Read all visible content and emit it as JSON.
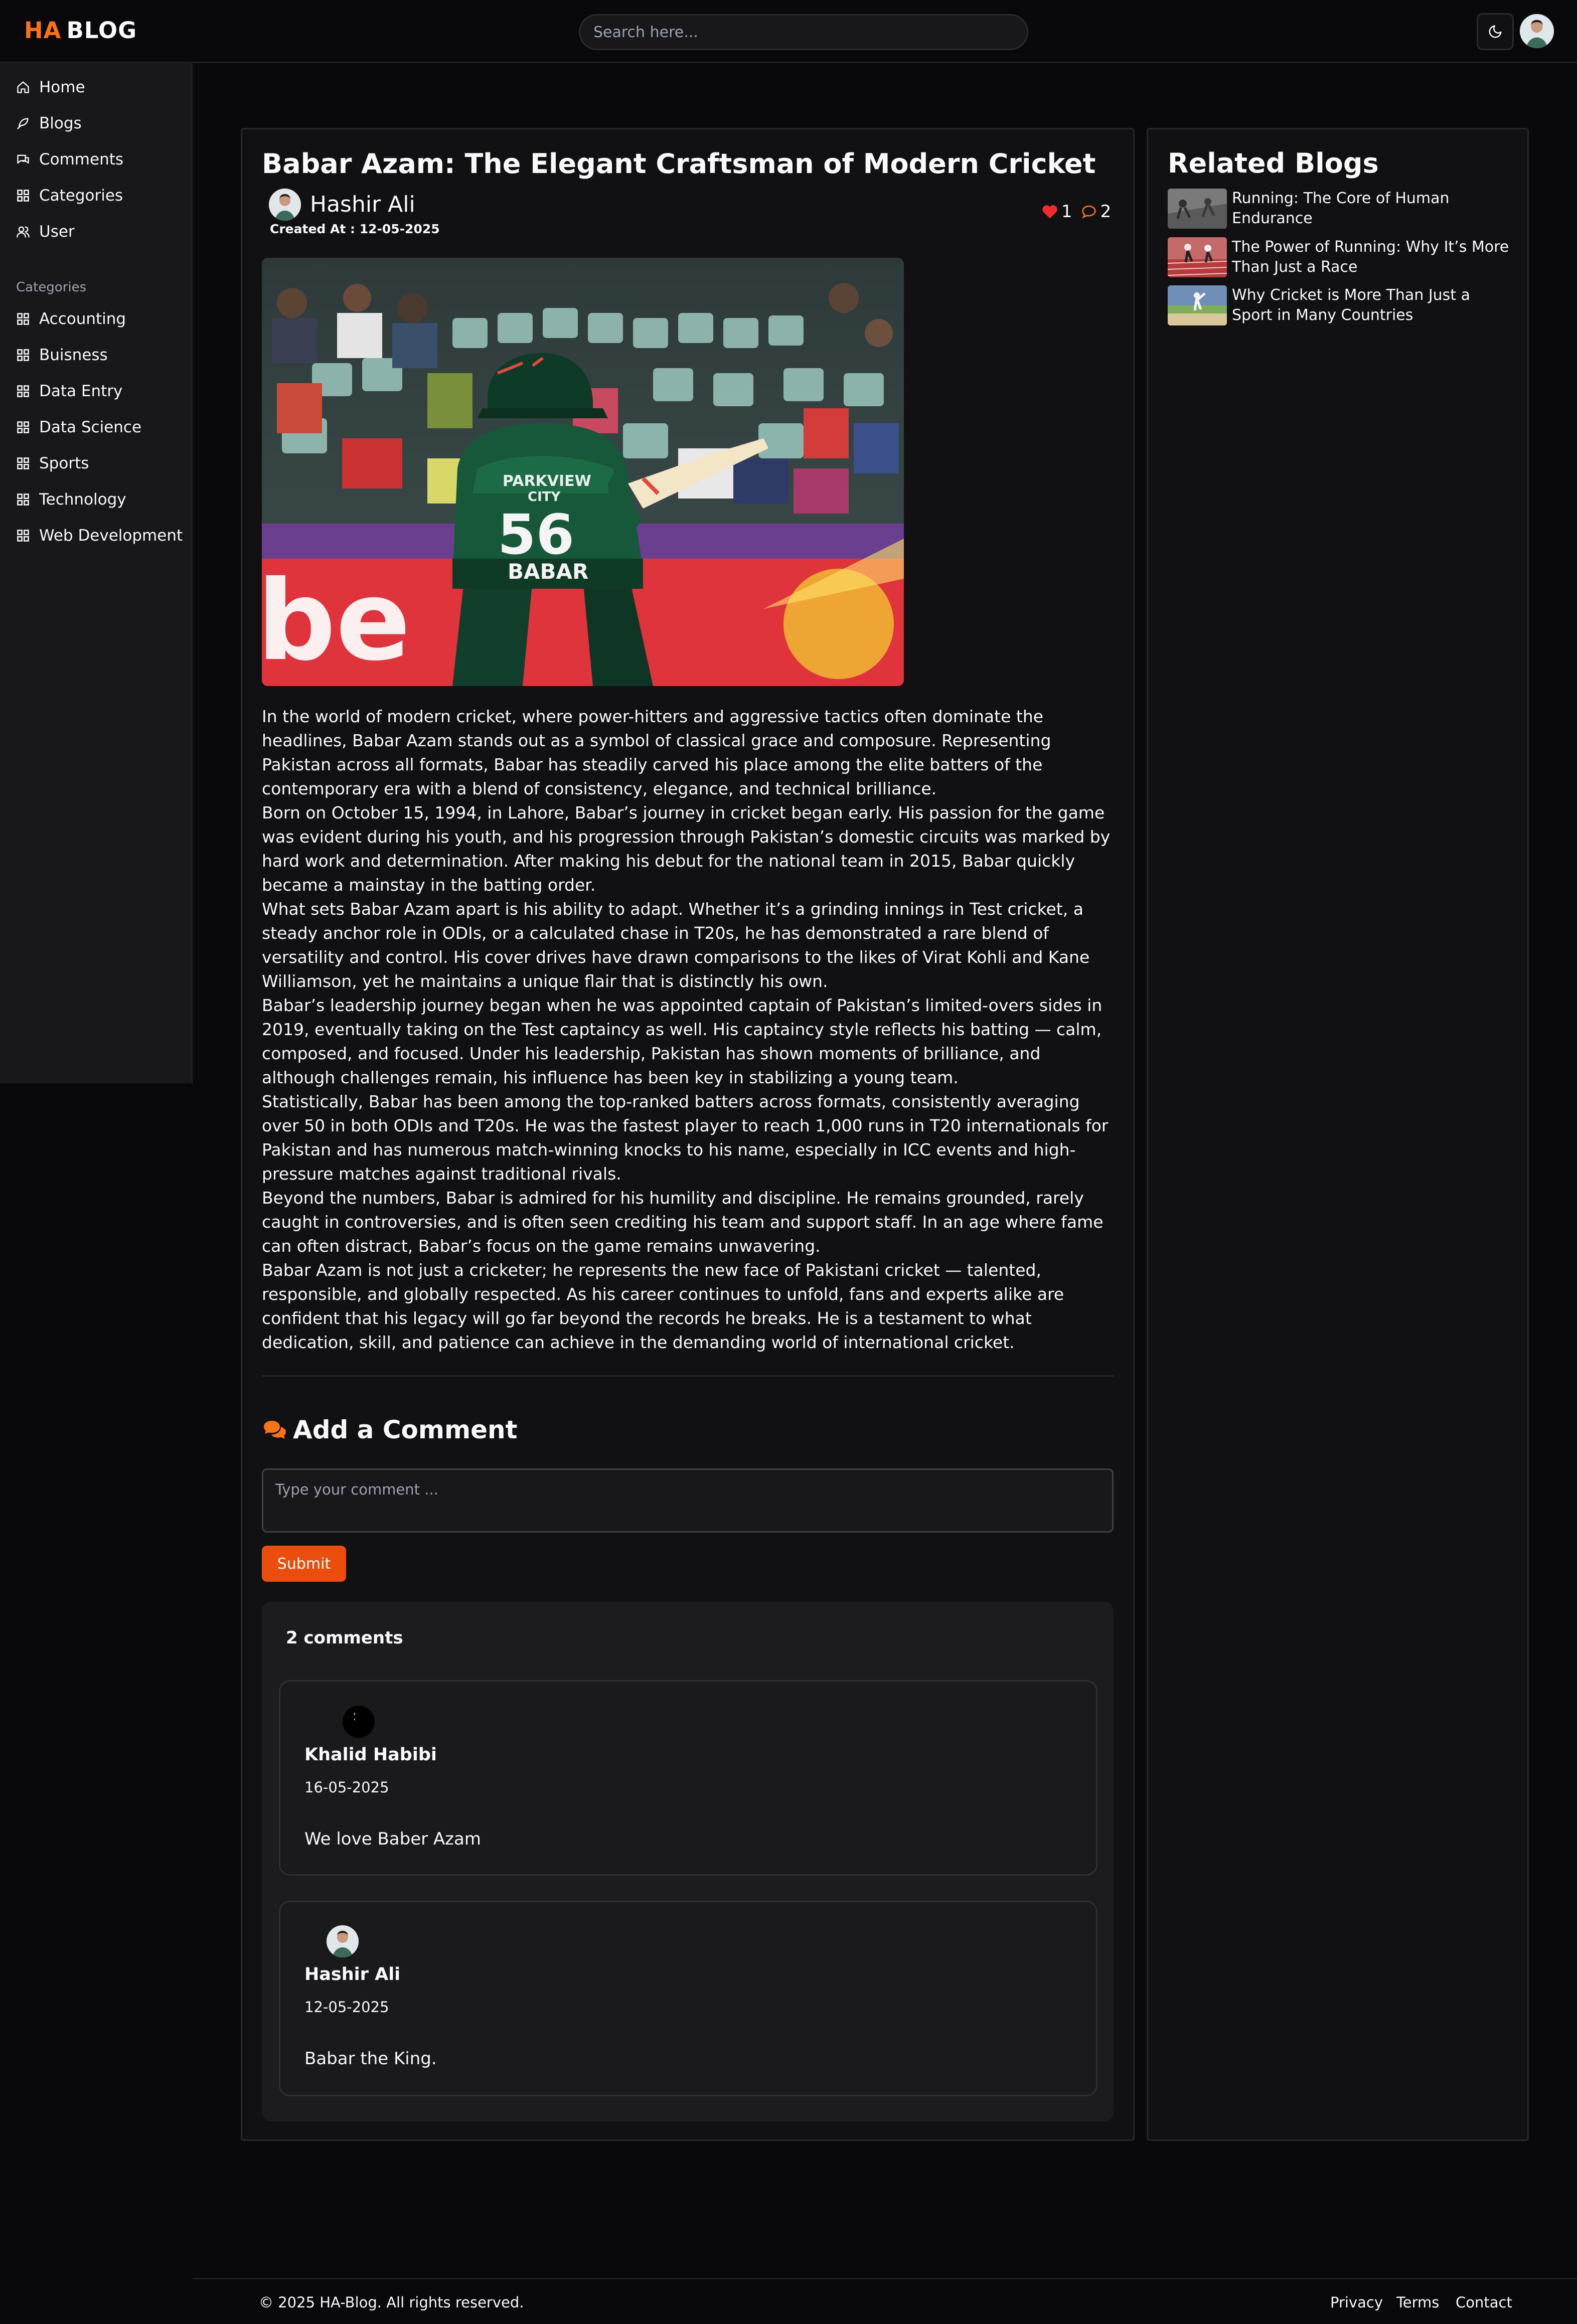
{
  "brand": {
    "prefix": "HA",
    "name": "BLOG",
    "accent": "#f97316"
  },
  "search": {
    "placeholder": "Search here..."
  },
  "header_icons": [
    "moon-icon",
    "user-avatar"
  ],
  "sidebar": {
    "items": [
      {
        "label": "Home",
        "icon": "home-icon"
      },
      {
        "label": "Blogs",
        "icon": "feather-icon"
      },
      {
        "label": "Comments",
        "icon": "comments-icon"
      },
      {
        "label": "Categories",
        "icon": "grid-icon"
      },
      {
        "label": "User",
        "icon": "users-icon"
      }
    ],
    "categories_heading": "Categories",
    "categories": [
      "Accounting",
      "Buisness",
      "Data Entry",
      "Data Science",
      "Sports",
      "Technology",
      "Web Development"
    ]
  },
  "post": {
    "title": "Babar Azam: The Elegant Craftsman of Modern Cricket",
    "author": "Hashir Ali",
    "created": "Created At : 12-05-2025",
    "likes": "1",
    "comments": "2",
    "paragraphs": [
      "In the world of modern cricket, where power-hitters and aggressive tactics often dominate the headlines, Babar Azam stands out as a symbol of classical grace and composure. Representing Pakistan across all formats, Babar has steadily carved his place among the elite batters of the contemporary era with a blend of consistency, elegance, and technical brilliance.",
      "Born on October 15, 1994, in Lahore, Babar’s journey in cricket began early. His passion for the game was evident during his youth, and his progression through Pakistan’s domestic circuits was marked by hard work and determination. After making his debut for the national team in 2015, Babar quickly became a mainstay in the batting order.",
      "What sets Babar Azam apart is his ability to adapt. Whether it’s a grinding innings in Test cricket, a steady anchor role in ODIs, or a calculated chase in T20s, he has demonstrated a rare blend of versatility and control. His cover drives have drawn comparisons to the likes of Virat Kohli and Kane Williamson, yet he maintains a unique flair that is distinctly his own.",
      "Babar’s leadership journey began when he was appointed captain of Pakistan’s limited-overs sides in 2019, eventually taking on the Test captaincy as well. His captaincy style reflects his batting — calm, composed, and focused. Under his leadership, Pakistan has shown moments of brilliance, and although challenges remain, his influence has been key in stabilizing a young team.",
      "Statistically, Babar has been among the top-ranked batters across formats, consistently averaging over 50 in both ODIs and T20s. He was the fastest player to reach 1,000 runs in T20 internationals for Pakistan and has numerous match-winning knocks to his name, especially in ICC events and high-pressure matches against traditional rivals.",
      "Beyond the numbers, Babar is admired for his humility and discipline. He remains grounded, rarely caught in controversies, and is often seen crediting his team and support staff. In an age where fame can often distract, Babar’s focus on the game remains unwavering.",
      "Babar Azam is not just a cricketer; he represents the new face of Pakistani cricket — talented, responsible, and globally respected. As his career continues to unfold, fans and experts alike are confident that his legacy will go far beyond the records he breaks. He is a testament to what dedication, skill, and patience can achieve in the demanding world of international cricket."
    ],
    "image_jersey": {
      "line1": "PARKVIEW",
      "line2": "CITY",
      "number": "56",
      "name": "BABAR"
    }
  },
  "comment_form": {
    "heading": "Add a Comment",
    "placeholder": "Type your comment ...",
    "submit": "Submit",
    "submit_color": "#ea4d0c"
  },
  "comments_section": {
    "count_label": "2 comments",
    "items": [
      {
        "name": "Khalid Habibi",
        "date": "16-05-2025",
        "text": "We love Baber Azam"
      },
      {
        "name": "Hashir Ali",
        "date": "12-05-2025",
        "text": "Babar the King."
      }
    ]
  },
  "related": {
    "title": "Related Blogs",
    "items": [
      {
        "title": "Running: The Core of Human Endurance"
      },
      {
        "title": "The Power of Running: Why It’s More Than Just a Race"
      },
      {
        "title": "Why Cricket is More Than Just a Sport in Many Countries"
      }
    ]
  },
  "footer": {
    "copyright": "© 2025 HA-Blog. All rights reserved.",
    "links": [
      "Privacy",
      "Terms",
      "Contact"
    ]
  }
}
